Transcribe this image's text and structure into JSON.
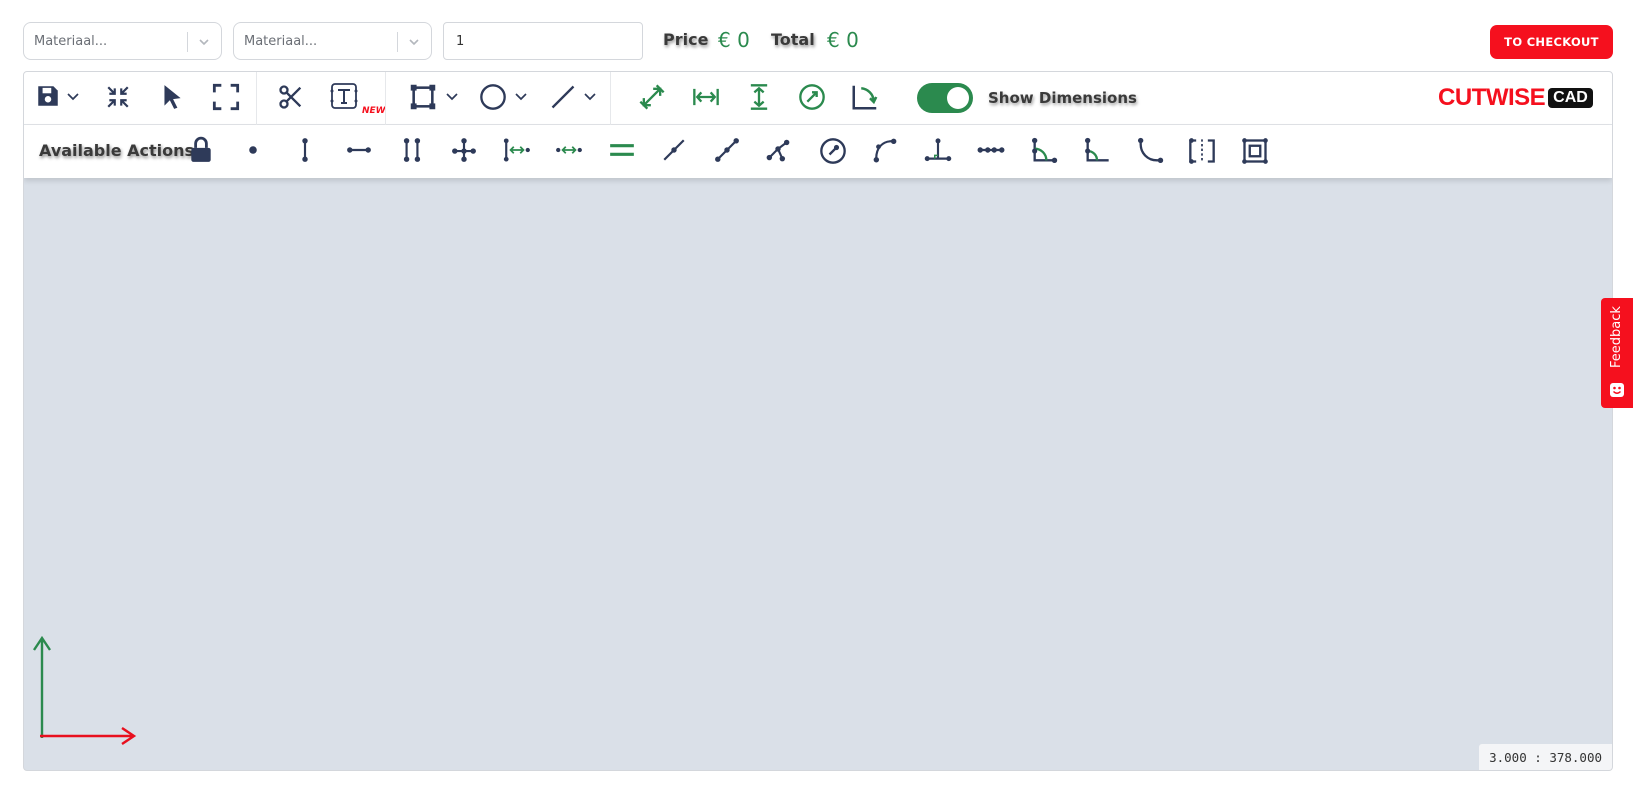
{
  "topbar": {
    "material_select_1": {
      "placeholder": "Materiaal..."
    },
    "material_select_2": {
      "placeholder": "Materiaal..."
    },
    "quantity": {
      "value": "1"
    },
    "price_label": "Price",
    "price_value": "€ 0",
    "total_label": "Total",
    "total_value": "€ 0",
    "checkout_label": "TO CHECKOUT"
  },
  "toolbar": {
    "show_dimensions_label": "Show Dimensions",
    "show_dimensions_on": true,
    "new_badge": "NEW",
    "logo_main": "CUTWISE",
    "logo_sub": "CAD"
  },
  "actions": {
    "label": "Available Actions"
  },
  "canvas": {
    "coords": "3.000 : 378.000",
    "bg_color": "#dae0e8",
    "axis_x_color": "#e8101e",
    "axis_y_color": "#2b8a4e"
  },
  "feedback": {
    "label": "Feedback"
  },
  "colors": {
    "accent": "#f5101e",
    "green": "#2b8a4e",
    "icon": "#2e3a59"
  }
}
